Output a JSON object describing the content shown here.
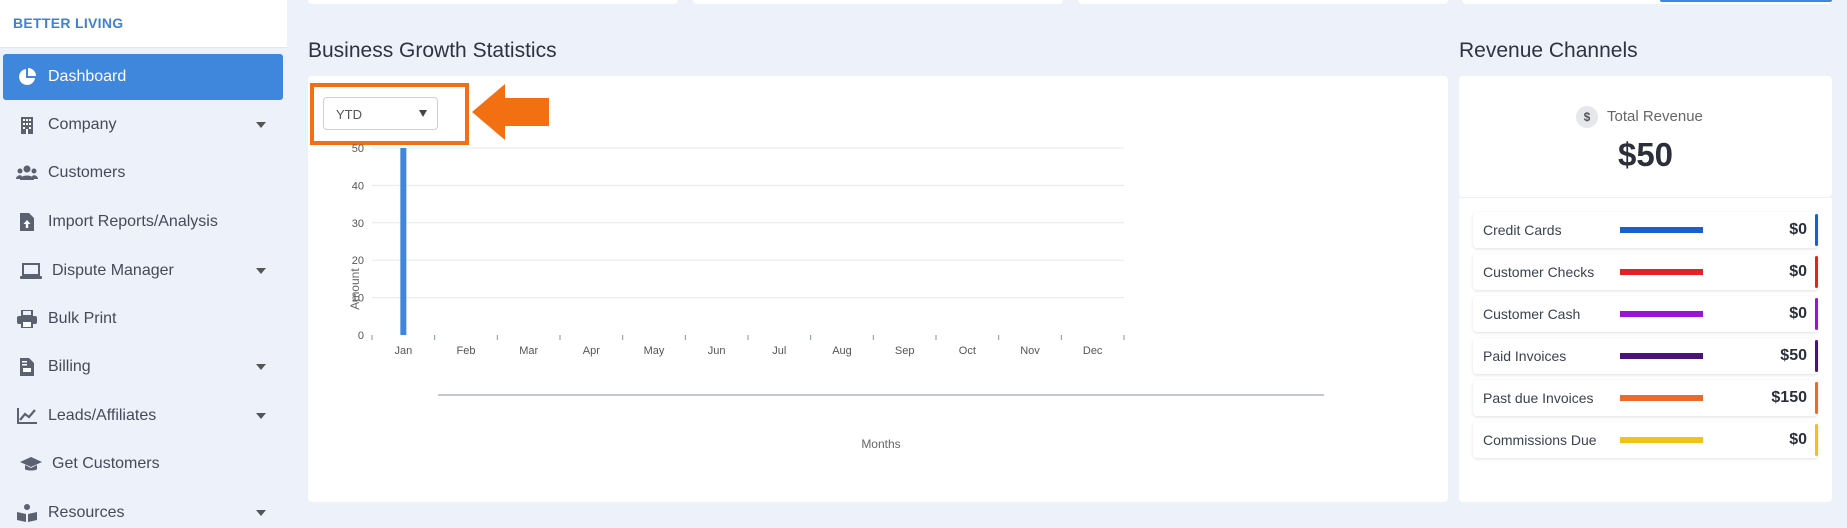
{
  "brand": "BETTER LIVING",
  "sidebar": {
    "items": [
      {
        "label": "Dashboard",
        "icon": "pie-chart-icon",
        "active": true,
        "has_caret": false
      },
      {
        "label": "Company",
        "icon": "building-icon",
        "has_caret": true
      },
      {
        "label": "Customers",
        "icon": "users-icon",
        "has_caret": false
      },
      {
        "label": "Import Reports/Analysis",
        "icon": "file-upload-icon",
        "has_caret": false
      },
      {
        "label": "Dispute Manager",
        "icon": "laptop-icon",
        "has_caret": true
      },
      {
        "label": "Bulk Print",
        "icon": "printer-icon",
        "has_caret": false
      },
      {
        "label": "Billing",
        "icon": "invoice-icon",
        "has_caret": true
      },
      {
        "label": "Leads/Affiliates",
        "icon": "line-chart-icon",
        "has_caret": true
      },
      {
        "label": "Get Customers",
        "icon": "graduation-cap-icon",
        "has_caret": false
      },
      {
        "label": "Resources",
        "icon": "book-reader-icon",
        "has_caret": true
      }
    ]
  },
  "business": {
    "title": "Business Growth Statistics",
    "period_select": {
      "value": "YTD"
    }
  },
  "chart_data": {
    "type": "bar",
    "categories": [
      "Jan",
      "Feb",
      "Mar",
      "Apr",
      "May",
      "Jun",
      "Jul",
      "Aug",
      "Sep",
      "Oct",
      "Nov",
      "Dec"
    ],
    "values": [
      50,
      0,
      0,
      0,
      0,
      0,
      0,
      0,
      0,
      0,
      0,
      0
    ],
    "xlabel": "Months",
    "ylabel": "Amount",
    "ylim": [
      0,
      50
    ],
    "yticks": [
      0,
      10,
      20,
      30,
      40,
      50
    ],
    "grid": true,
    "bar_color": "#3f86dd"
  },
  "revenue": {
    "title": "Revenue Channels",
    "total_label": "Total Revenue",
    "total_value": "$50",
    "dollar_symbol": "$",
    "channels": [
      {
        "name": "Credit Cards",
        "value": "$0",
        "color": "#1a5fcc"
      },
      {
        "name": "Customer Checks",
        "value": "$0",
        "color": "#e52222"
      },
      {
        "name": "Customer Cash",
        "value": "$0",
        "color": "#9a14d4"
      },
      {
        "name": "Paid Invoices",
        "value": "$50",
        "color": "#4a127a"
      },
      {
        "name": "Past due Invoices",
        "value": "$150",
        "color": "#ec6a2a"
      },
      {
        "name": "Commissions Due",
        "value": "$0",
        "color": "#f2c315"
      }
    ]
  },
  "annotation": {
    "color": "#f26f12"
  }
}
